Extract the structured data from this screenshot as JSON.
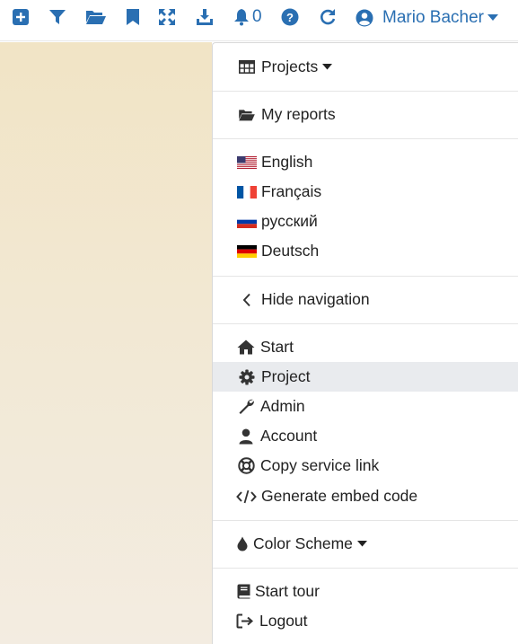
{
  "topbar": {
    "icons": [
      "add-icon",
      "filter-icon",
      "folder-open-icon",
      "bookmark-icon",
      "expand-icon",
      "download-icon",
      "bell-icon",
      "help-icon",
      "refresh-icon"
    ],
    "notification_count": "0",
    "user_name": "Mario Bacher",
    "accent": "#2a6fb2"
  },
  "menu": {
    "projects": "Projects",
    "my_reports": "My reports",
    "languages": [
      "English",
      "Français",
      "русский",
      "Deutsch"
    ],
    "hide_navigation": "Hide navigation",
    "start": "Start",
    "project": "Project",
    "admin": "Admin",
    "account": "Account",
    "copy_service_link": "Copy service link",
    "generate_embed_code": "Generate embed code",
    "color_scheme": "Color Scheme",
    "start_tour": "Start tour",
    "logout": "Logout",
    "active_item": "Project"
  }
}
